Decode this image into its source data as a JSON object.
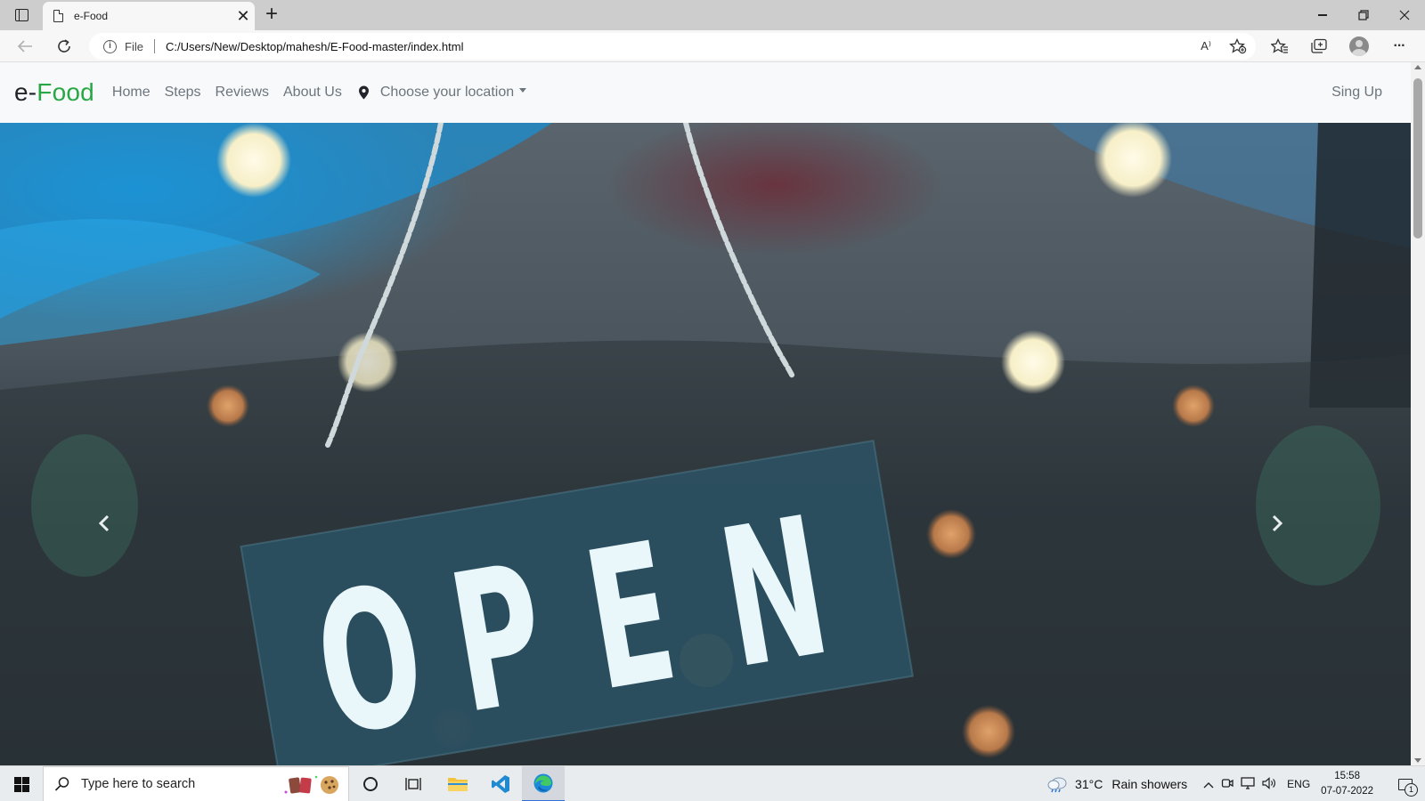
{
  "browser": {
    "tab_title": "e-Food",
    "tab_close": "✕",
    "new_tab": "+",
    "protocol_label": "File",
    "url": "C:/Users/New/Desktop/mahesh/E-Food-master/index.html",
    "icons": [
      "tab-actions-icon",
      "page-icon",
      "back-icon",
      "reload-icon",
      "info-icon",
      "read-aloud-icon",
      "add-favorite-icon",
      "favorites-icon",
      "collections-icon",
      "profile-icon",
      "more-icon"
    ],
    "read_aloud_glyph": "A⁾",
    "more_glyph": "···"
  },
  "site": {
    "brand_prefix": "e-",
    "brand_accent": "Food",
    "accent_color": "#28a745",
    "nav": [
      {
        "label": "Home"
      },
      {
        "label": "Steps"
      },
      {
        "label": "Reviews"
      },
      {
        "label": "About Us"
      }
    ],
    "location_label": "Choose your location",
    "signup_label": "Sing Up",
    "carousel": {
      "prev_glyph": "‹",
      "next_glyph": "›",
      "slide_text": [
        "O",
        "P",
        "E",
        "N"
      ]
    }
  },
  "taskbar": {
    "search_placeholder": "Type here to search",
    "weather_temp": "31°C",
    "weather_desc": "Rain showers",
    "language": "ENG",
    "time": "15:58",
    "date": "07-07-2022",
    "notification_count": "1",
    "tray_chevron": "^"
  }
}
